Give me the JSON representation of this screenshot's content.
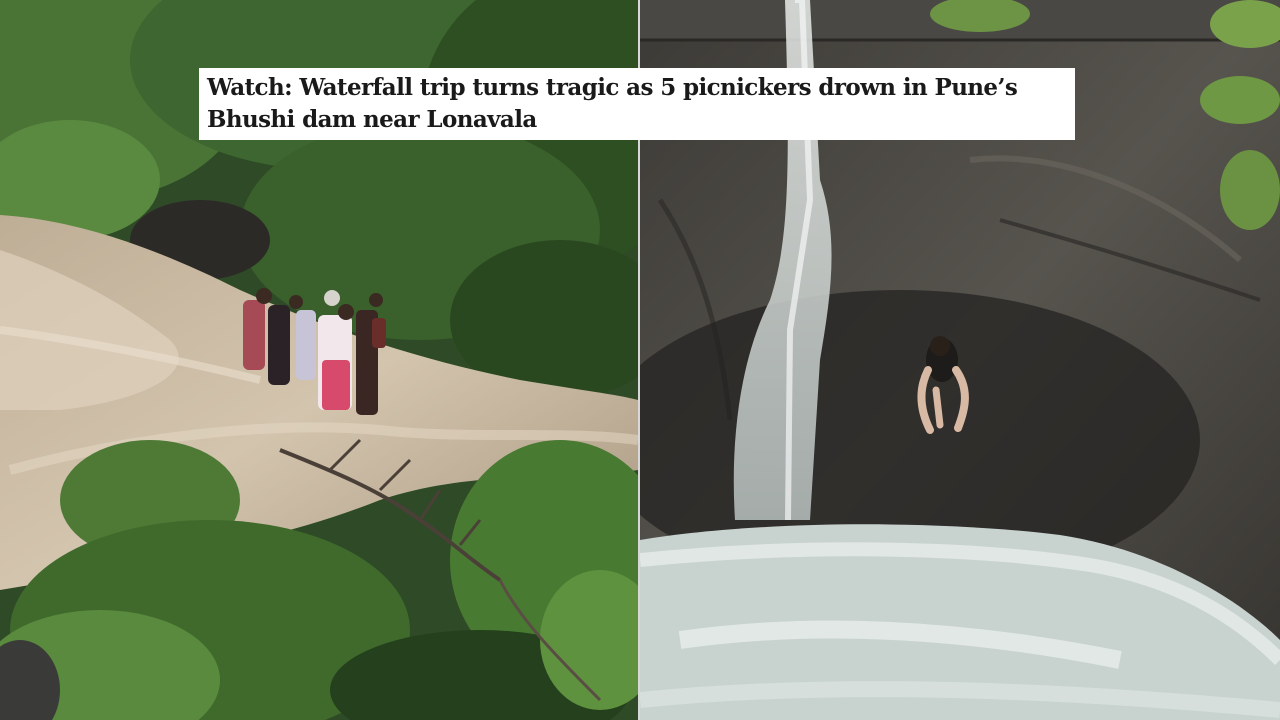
{
  "headline": {
    "text": "Watch: Waterfall trip turns tragic as 5 picnickers drown in Pune’s Bhushi dam near Lonavala"
  },
  "left_photo": {
    "scene": "group-stranded-in-floodwater",
    "colors": {
      "water": "#c9b8a2",
      "foliage": "#3f6a2c",
      "dark_foliage": "#24401c"
    }
  },
  "right_photo": {
    "scene": "person-jumping-into-waterfall-pool",
    "colors": {
      "rock": "#4d4b46",
      "waterfall": "#d9dcda",
      "pool": "#c6d0cd"
    }
  }
}
